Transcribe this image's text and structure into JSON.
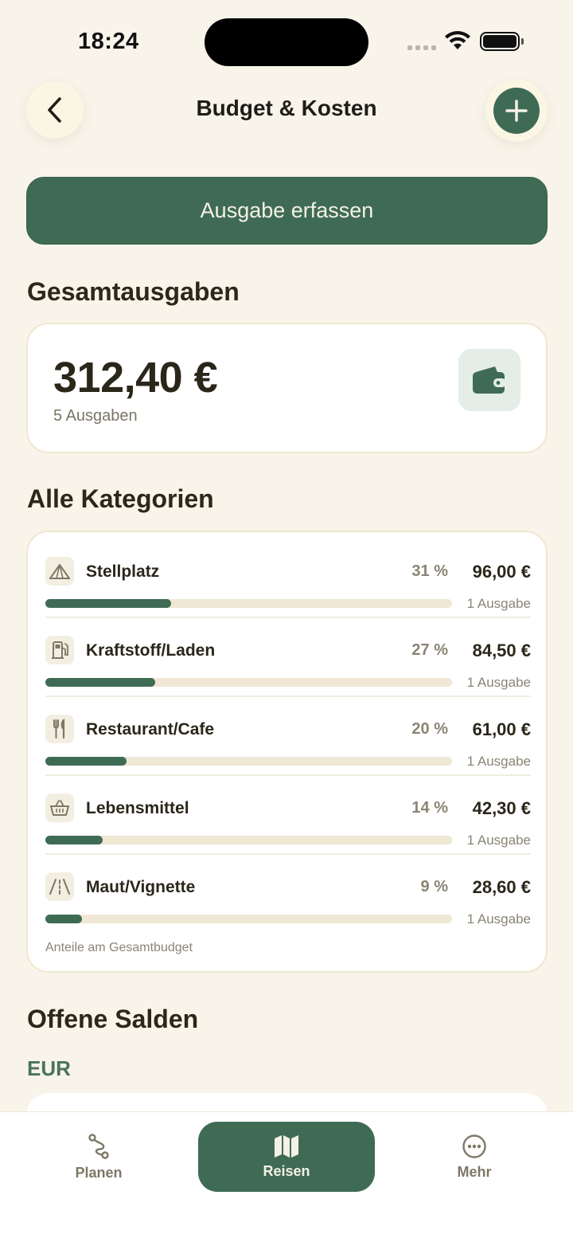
{
  "status": {
    "time": "18:24"
  },
  "header": {
    "title": "Budget & Kosten"
  },
  "primary_button": "Ausgabe erfassen",
  "summary": {
    "section_title": "Gesamtausgaben",
    "total": "312,40 €",
    "count": "5 Ausgaben",
    "icon": "wallet-icon"
  },
  "categories": {
    "section_title": "Alle Kategorien",
    "items": [
      {
        "name": "Stellplatz",
        "percent": "31 %",
        "amount": "96,00 €",
        "count": "1 Ausgabe",
        "share": 0.31,
        "icon": "tent-icon"
      },
      {
        "name": "Kraftstoff/Laden",
        "percent": "27 %",
        "amount": "84,50 €",
        "count": "1 Ausgabe",
        "share": 0.27,
        "icon": "fuel-pump-icon"
      },
      {
        "name": "Restaurant/Cafe",
        "percent": "20 %",
        "amount": "61,00 €",
        "count": "1 Ausgabe",
        "share": 0.2,
        "icon": "fork-knife-icon"
      },
      {
        "name": "Lebensmittel",
        "percent": "14 %",
        "amount": "42,30 €",
        "count": "1 Ausgabe",
        "share": 0.14,
        "icon": "basket-icon"
      },
      {
        "name": "Maut/Vignette",
        "percent": "9 %",
        "amount": "28,60 €",
        "count": "1 Ausgabe",
        "share": 0.09,
        "icon": "road-icon"
      }
    ],
    "footnote": "Anteile am Gesamtbudget"
  },
  "balances": {
    "section_title": "Offene Salden",
    "currency": "EUR"
  },
  "tabs": [
    {
      "label": "Planen",
      "icon": "route-icon",
      "active": false
    },
    {
      "label": "Reisen",
      "icon": "map-icon",
      "active": true
    },
    {
      "label": "Mehr",
      "icon": "more-icon",
      "active": false
    }
  ],
  "colors": {
    "accent": "#3f6b55",
    "background": "#f8f4ea",
    "bar_track": "#f0e7d4"
  }
}
